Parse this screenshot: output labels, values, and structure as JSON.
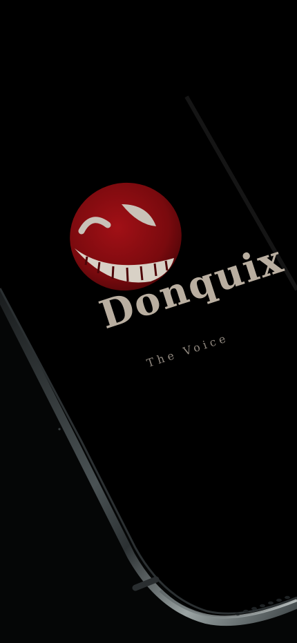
{
  "app": {
    "name": "Donquix",
    "tagline": "The Voice"
  },
  "colors": {
    "background": "#000000",
    "logo_face": "#7a0a0e",
    "logo_face_highlight": "#a11016",
    "text_primary": "#b9aea0",
    "text_secondary": "#8f877e",
    "device_frame": "#3a3f41"
  },
  "icons": {
    "logo": "grinning-winking-face-icon"
  }
}
